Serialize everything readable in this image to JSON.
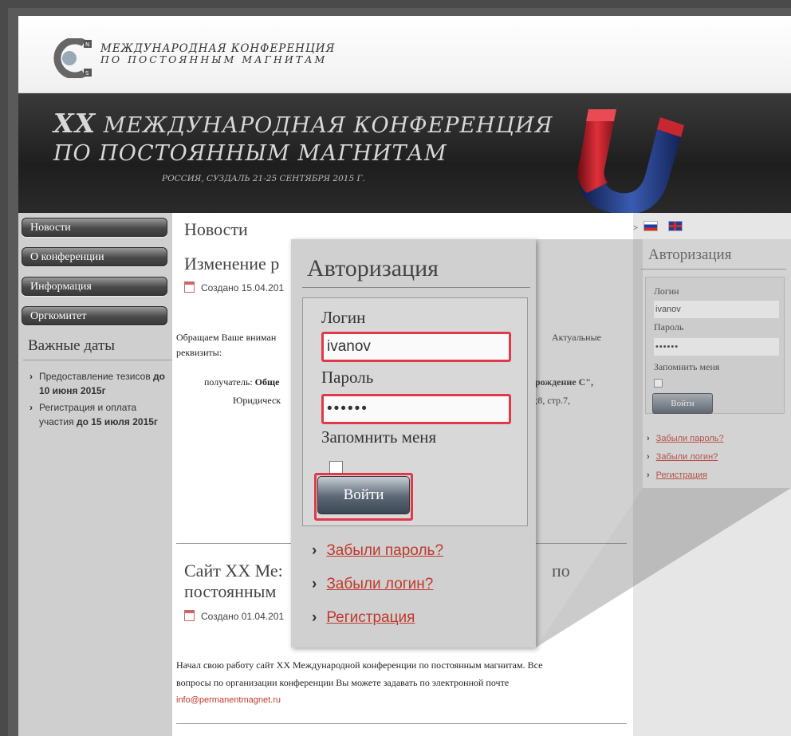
{
  "header": {
    "logo_line1": "МЕЖДУНАРОДНАЯ КОНФЕРЕНЦИЯ",
    "logo_line2": "ПО ПОСТОЯННЫМ МАГНИТАМ"
  },
  "banner": {
    "xx": "XX",
    "line1": " МЕЖДУНАРОДНАЯ КОНФЕРЕНЦИЯ",
    "line2": "ПО ПОСТОЯННЫМ МАГНИТАМ",
    "line3": "РОССИЯ, СУЗДАЛЬ 21-25 СЕНТЯБРЯ 2015 Г."
  },
  "nav": {
    "items": [
      {
        "label": "Новости"
      },
      {
        "label": "О конференции"
      },
      {
        "label": "Информация"
      },
      {
        "label": "Оргкомитет"
      }
    ]
  },
  "sidebar": {
    "heading": "Важные даты",
    "dates": [
      {
        "text": "Предоставление тезисов",
        "strong": "до 10 июня 2015г"
      },
      {
        "text": "Регистрация и оплата участия",
        "strong": "до 15 июля 2015г"
      }
    ]
  },
  "content": {
    "title": "Новости",
    "article1_title": "Изменение р",
    "article1_meta": "Создано 15.04.201",
    "article1_p1a": "Обращаем Ваше вниман",
    "article1_p1b": "Актуальные",
    "article1_p1c": "реквизиты:",
    "article1_p2a": "получатель: ",
    "article1_p2a_strong": "Обще",
    "article1_p2b": "рождение С\",",
    "article1_p3a": "Юридическ",
    "article1_p3b": ";8, стр.7,",
    "article2_title": "Сайт XX Ме: постоянным",
    "article2_title_tail": "по",
    "article2_meta": "Создано 01.04.201",
    "article2_text1": "Начал свою работу сайт XX Международной конференции по постоянным магнитам. Все",
    "article2_text2": "вопросы по организации конференции Вы можете задавать по электронной почте",
    "article2_email": "info@permanentmagnet.ru"
  },
  "right": {
    "flags_arrow": ">",
    "auth_title": "Авторизация",
    "login_label": "Логин",
    "login_value": "ivanov",
    "password_label": "Пароль",
    "password_value": "••••••",
    "remember_label": "Запомнить меня",
    "submit_label": "Войти",
    "links": [
      "Забыли пароль?",
      "Забыли логин?",
      "Регистрация"
    ]
  },
  "zoom": {
    "auth_title": "Авторизация",
    "login_label": "Логин",
    "login_value": "ivanov",
    "password_label": "Пароль",
    "password_value": "••••••",
    "remember_label": "Запомнить меня",
    "submit_label": "Войти",
    "links": [
      "Забыли пароль?",
      "Забыли логин?",
      "Регистрация"
    ]
  },
  "colors": {
    "highlight": "#e0394a",
    "link": "#c0392b"
  }
}
